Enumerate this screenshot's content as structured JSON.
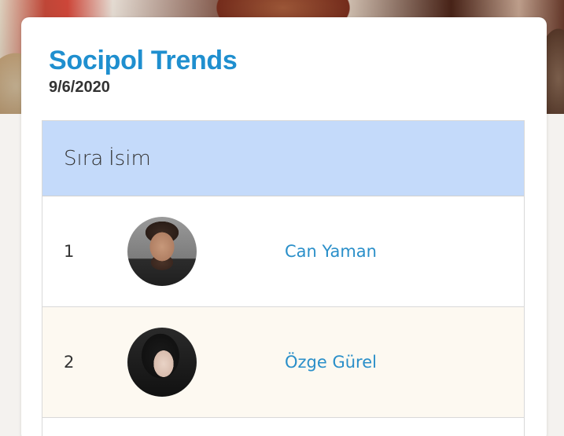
{
  "header": {
    "title": "Socipol Trends",
    "date": "9/6/2020"
  },
  "table": {
    "columns": [
      "Sıra",
      "İsim"
    ],
    "rows": [
      {
        "rank": "1",
        "name": "Can Yaman",
        "avatar": "person-photo"
      },
      {
        "rank": "2",
        "name": "Özge Gürel",
        "avatar": "person-photo"
      }
    ]
  },
  "colors": {
    "title": "#1f8fcf",
    "header_bg": "#c4dafa",
    "alt_row_bg": "#fdf9f1",
    "link": "#2a8fc9"
  }
}
